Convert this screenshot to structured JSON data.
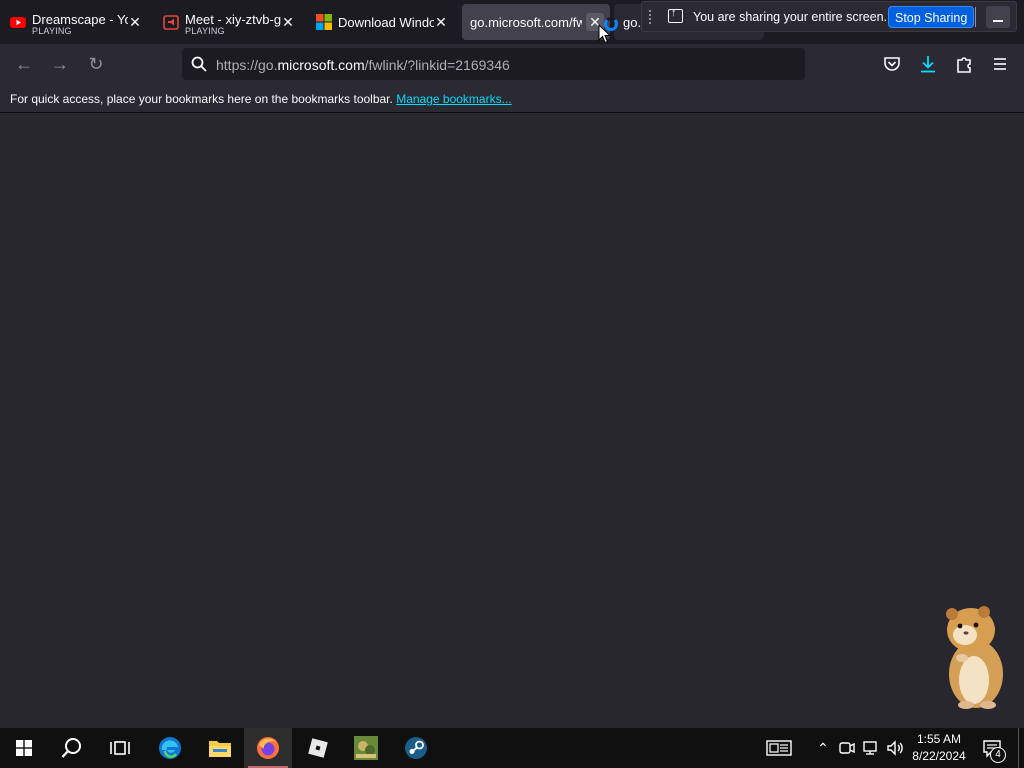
{
  "tabs": [
    {
      "title": "Dreamscape - You",
      "subtitle": "PLAYING",
      "icon": "youtube-icon"
    },
    {
      "title": "Meet - xiy-ztvb-g",
      "subtitle": "PLAYING",
      "icon": "meet-icon"
    },
    {
      "title": "Download Windo",
      "subtitle": "",
      "icon": "microsoft-icon"
    },
    {
      "title": "go.microsoft.com/fw",
      "subtitle": "",
      "icon": ""
    },
    {
      "title": "go.",
      "subtitle": "",
      "icon": "loading-icon"
    }
  ],
  "sharing": {
    "message": "You are sharing your entire screen.",
    "stop_label": "Stop Sharing"
  },
  "nav": {
    "url_prefix": "https://go.",
    "url_domain": "microsoft.com",
    "url_path": "/fwlink/?linkid=2169346"
  },
  "bookmarks": {
    "message": "For quick access, place your bookmarks here on the bookmarks toolbar.",
    "manage_label": "Manage bookmarks..."
  },
  "taskbar": {
    "time": "1:55 AM",
    "date": "8/22/2024",
    "notification_count": "4"
  },
  "colors": {
    "accent": "#0060df",
    "link": "#00ddff",
    "background": "#1c1b22"
  }
}
